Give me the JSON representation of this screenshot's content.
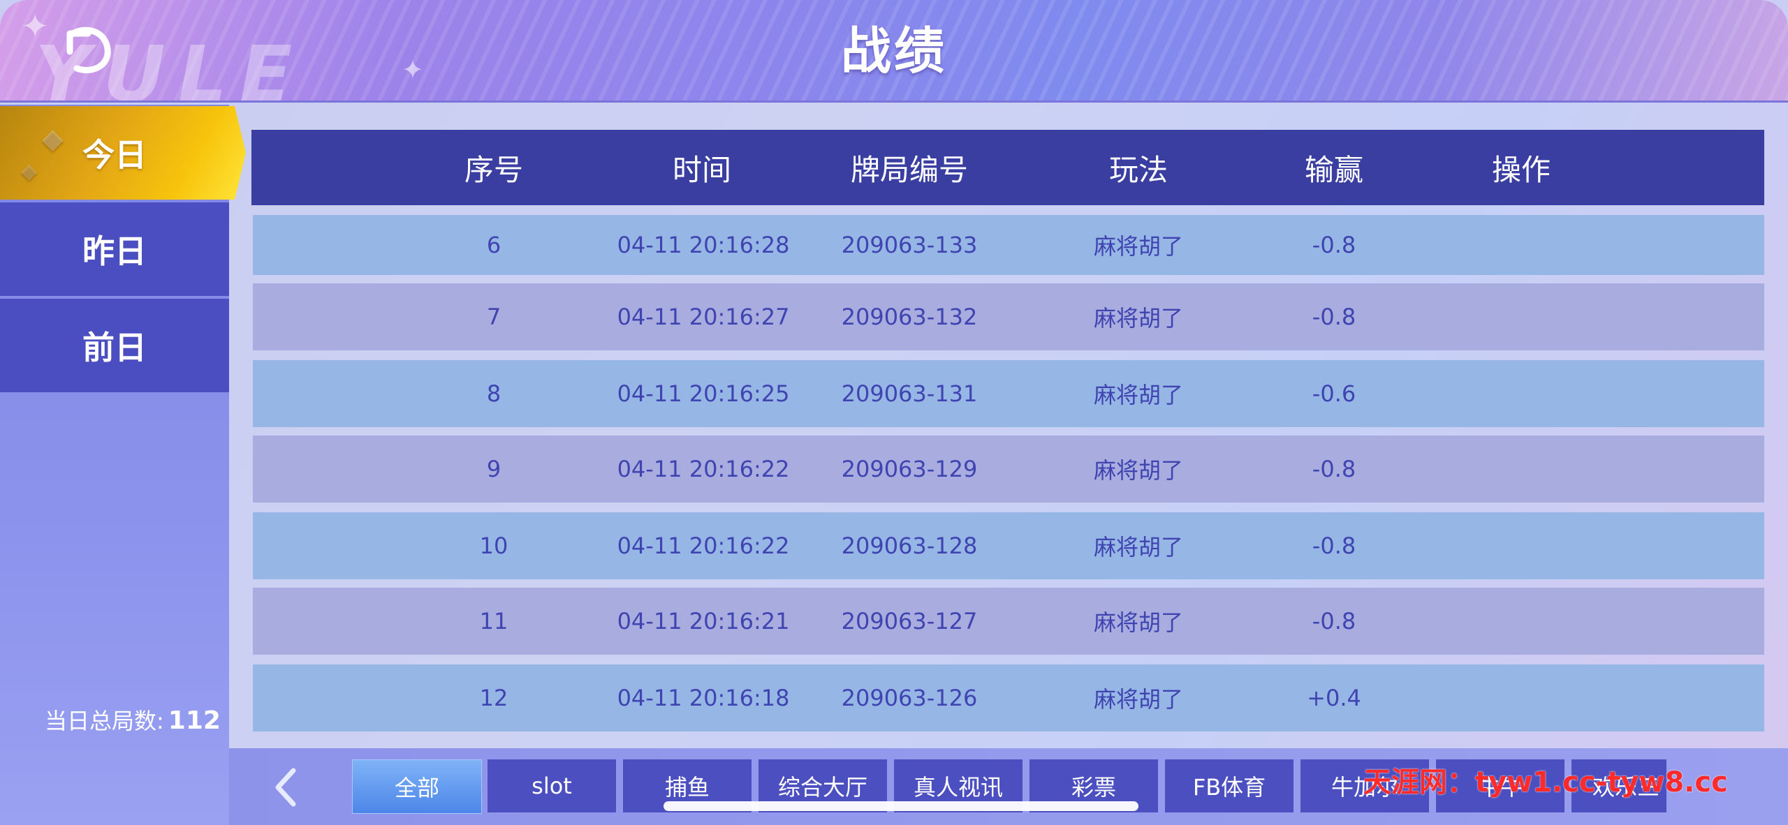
{
  "header": {
    "title": "战绩",
    "logo_text": "YULE"
  },
  "sidebar": {
    "items": [
      {
        "label": "今日"
      },
      {
        "label": "昨日"
      },
      {
        "label": "前日"
      }
    ],
    "total_label": "当日总局数:",
    "total_value": "112"
  },
  "table": {
    "columns": [
      "序号",
      "时间",
      "牌局编号",
      "玩法",
      "输赢",
      "操作"
    ],
    "rows": [
      {
        "no": "6",
        "time": "04-11 20:16:28",
        "game_id": "209063-133",
        "mode": "麻将胡了",
        "result": "-0.8"
      },
      {
        "no": "7",
        "time": "04-11 20:16:27",
        "game_id": "209063-132",
        "mode": "麻将胡了",
        "result": "-0.8"
      },
      {
        "no": "8",
        "time": "04-11 20:16:25",
        "game_id": "209063-131",
        "mode": "麻将胡了",
        "result": "-0.6"
      },
      {
        "no": "9",
        "time": "04-11 20:16:22",
        "game_id": "209063-129",
        "mode": "麻将胡了",
        "result": "-0.8"
      },
      {
        "no": "10",
        "time": "04-11 20:16:22",
        "game_id": "209063-128",
        "mode": "麻将胡了",
        "result": "-0.8"
      },
      {
        "no": "11",
        "time": "04-11 20:16:21",
        "game_id": "209063-127",
        "mode": "麻将胡了",
        "result": "-0.8"
      },
      {
        "no": "12",
        "time": "04-11 20:16:18",
        "game_id": "209063-126",
        "mode": "麻将胡了",
        "result": "+0.4"
      }
    ]
  },
  "tabs": [
    "全部",
    "slot",
    "捕鱼",
    "综合大厅",
    "真人视讯",
    "彩票",
    "FB体育",
    "牛加尔",
    "牛牛",
    "欢乐三"
  ],
  "watermark": "天涯网：tyw1.cc-tyw8.cc",
  "colors": {
    "active_tab": "#4d86e8",
    "active_sidebar": "#f7c40c",
    "header_row": "#393ea0",
    "row_text": "#3f44b0",
    "watermark": "#ff2a2a"
  }
}
